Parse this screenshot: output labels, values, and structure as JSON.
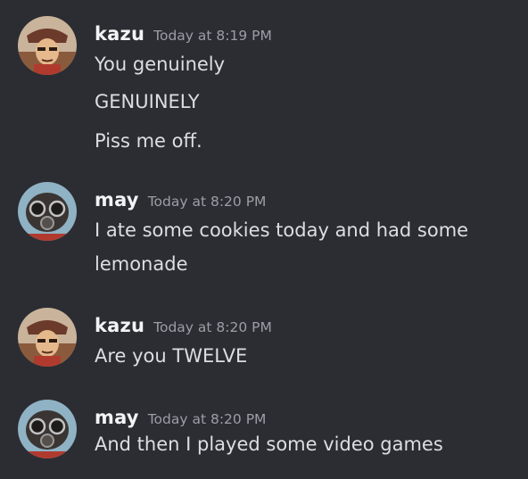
{
  "messages": [
    {
      "author": "kazu",
      "timestamp": "Today at 8:19 PM",
      "avatar_icon": "soldier-avatar-icon",
      "lines": [
        "You genuinely",
        "GENUINELY",
        "Piss me off."
      ]
    },
    {
      "author": "may",
      "timestamp": "Today at 8:20 PM",
      "avatar_icon": "gasmask-avatar-icon",
      "lines": [
        "I ate some cookies today and had some",
        "lemonade"
      ]
    },
    {
      "author": "kazu",
      "timestamp": "Today at 8:20 PM",
      "avatar_icon": "soldier-avatar-icon",
      "lines": [
        "Are you TWELVE"
      ]
    },
    {
      "author": "may",
      "timestamp": "Today at 8:20 PM",
      "avatar_icon": "gasmask-avatar-icon",
      "lines": [
        "And then I played some video games"
      ]
    }
  ],
  "colors": {
    "background": "#2b2d33",
    "author": "#f2f3f5",
    "timestamp": "#9b9ea6",
    "message_text": "#dcdee3"
  }
}
